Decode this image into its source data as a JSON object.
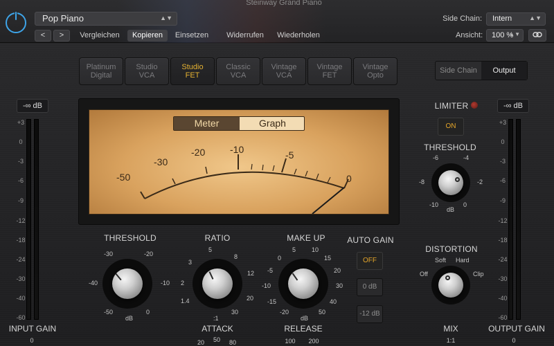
{
  "header": {
    "instrument_title": "Steinway Grand Piano",
    "preset_name": "Pop Piano",
    "nav_prev": "<",
    "nav_next": ">",
    "buttons": [
      "Vergleichen",
      "Kopieren",
      "Einsetzen",
      "Widerrufen",
      "Wiederholen"
    ],
    "active_button": "Kopieren",
    "side_chain_label": "Side Chain:",
    "side_chain_value": "Intern",
    "view_label": "Ansicht:",
    "zoom_value": "100 %",
    "link_icon": "link-icon"
  },
  "models": [
    {
      "line1": "Platinum",
      "line2": "Digital"
    },
    {
      "line1": "Studio",
      "line2": "VCA"
    },
    {
      "line1": "Studio",
      "line2": "FET"
    },
    {
      "line1": "Classic",
      "line2": "VCA"
    },
    {
      "line1": "Vintage",
      "line2": "VCA"
    },
    {
      "line1": "Vintage",
      "line2": "FET"
    },
    {
      "line1": "Vintage",
      "line2": "Opto"
    }
  ],
  "active_model_index": 2,
  "view_toggle": {
    "side_chain": "Side Chain",
    "output": "Output",
    "active": "Output"
  },
  "input_meter": {
    "readout": "-∞ dB",
    "label": "INPUT GAIN",
    "value": "0"
  },
  "output_meter": {
    "readout": "-∞ dB",
    "label": "OUTPUT GAIN",
    "value": "0"
  },
  "meter_scale": [
    "+3",
    "0",
    "-3",
    "-6",
    "-9",
    "-12",
    "-18",
    "-24",
    "-30",
    "-40",
    "-60"
  ],
  "vu": {
    "tabs": [
      "Meter",
      "Graph"
    ],
    "active_tab": "Meter",
    "scale_labels": [
      "-50",
      "-30",
      "-20",
      "-10",
      "-5",
      "0"
    ]
  },
  "threshold": {
    "title": "THRESHOLD",
    "ticks": [
      "-30",
      "-20",
      "-40",
      "-10",
      "-50",
      "0"
    ],
    "unit": "dB"
  },
  "ratio": {
    "title": "RATIO",
    "ticks": [
      "5",
      "8",
      "3",
      "12",
      "2",
      "20",
      "1.4",
      "30",
      ":1"
    ]
  },
  "makeup": {
    "title": "MAKE UP",
    "ticks": [
      "5",
      "10",
      "0",
      "15",
      "-5",
      "20",
      "-10",
      "30",
      "-15",
      "40",
      "-20",
      "50"
    ],
    "unit": "dB"
  },
  "auto_gain": {
    "title": "AUTO GAIN",
    "buttons": [
      "OFF",
      "0 dB",
      "-12 dB"
    ],
    "active": "OFF"
  },
  "attack": {
    "title": "ATTACK",
    "values": [
      "20",
      "50",
      "80"
    ]
  },
  "release": {
    "title": "RELEASE",
    "values": [
      "100",
      "200"
    ]
  },
  "limiter": {
    "title": "LIMITER",
    "button": "ON",
    "threshold_title": "THRESHOLD",
    "ticks": [
      "-6",
      "-4",
      "-8",
      "-2",
      "-10",
      "0"
    ],
    "unit": "dB"
  },
  "distortion": {
    "title": "DISTORTION",
    "ticks": [
      "Soft",
      "Hard",
      "Off",
      "Clip"
    ]
  },
  "mix": {
    "title": "MIX",
    "value": "1:1"
  },
  "colors": {
    "accent": "#e5b232",
    "power": "#3ea4e8",
    "vu_face": "#d9a25e"
  }
}
